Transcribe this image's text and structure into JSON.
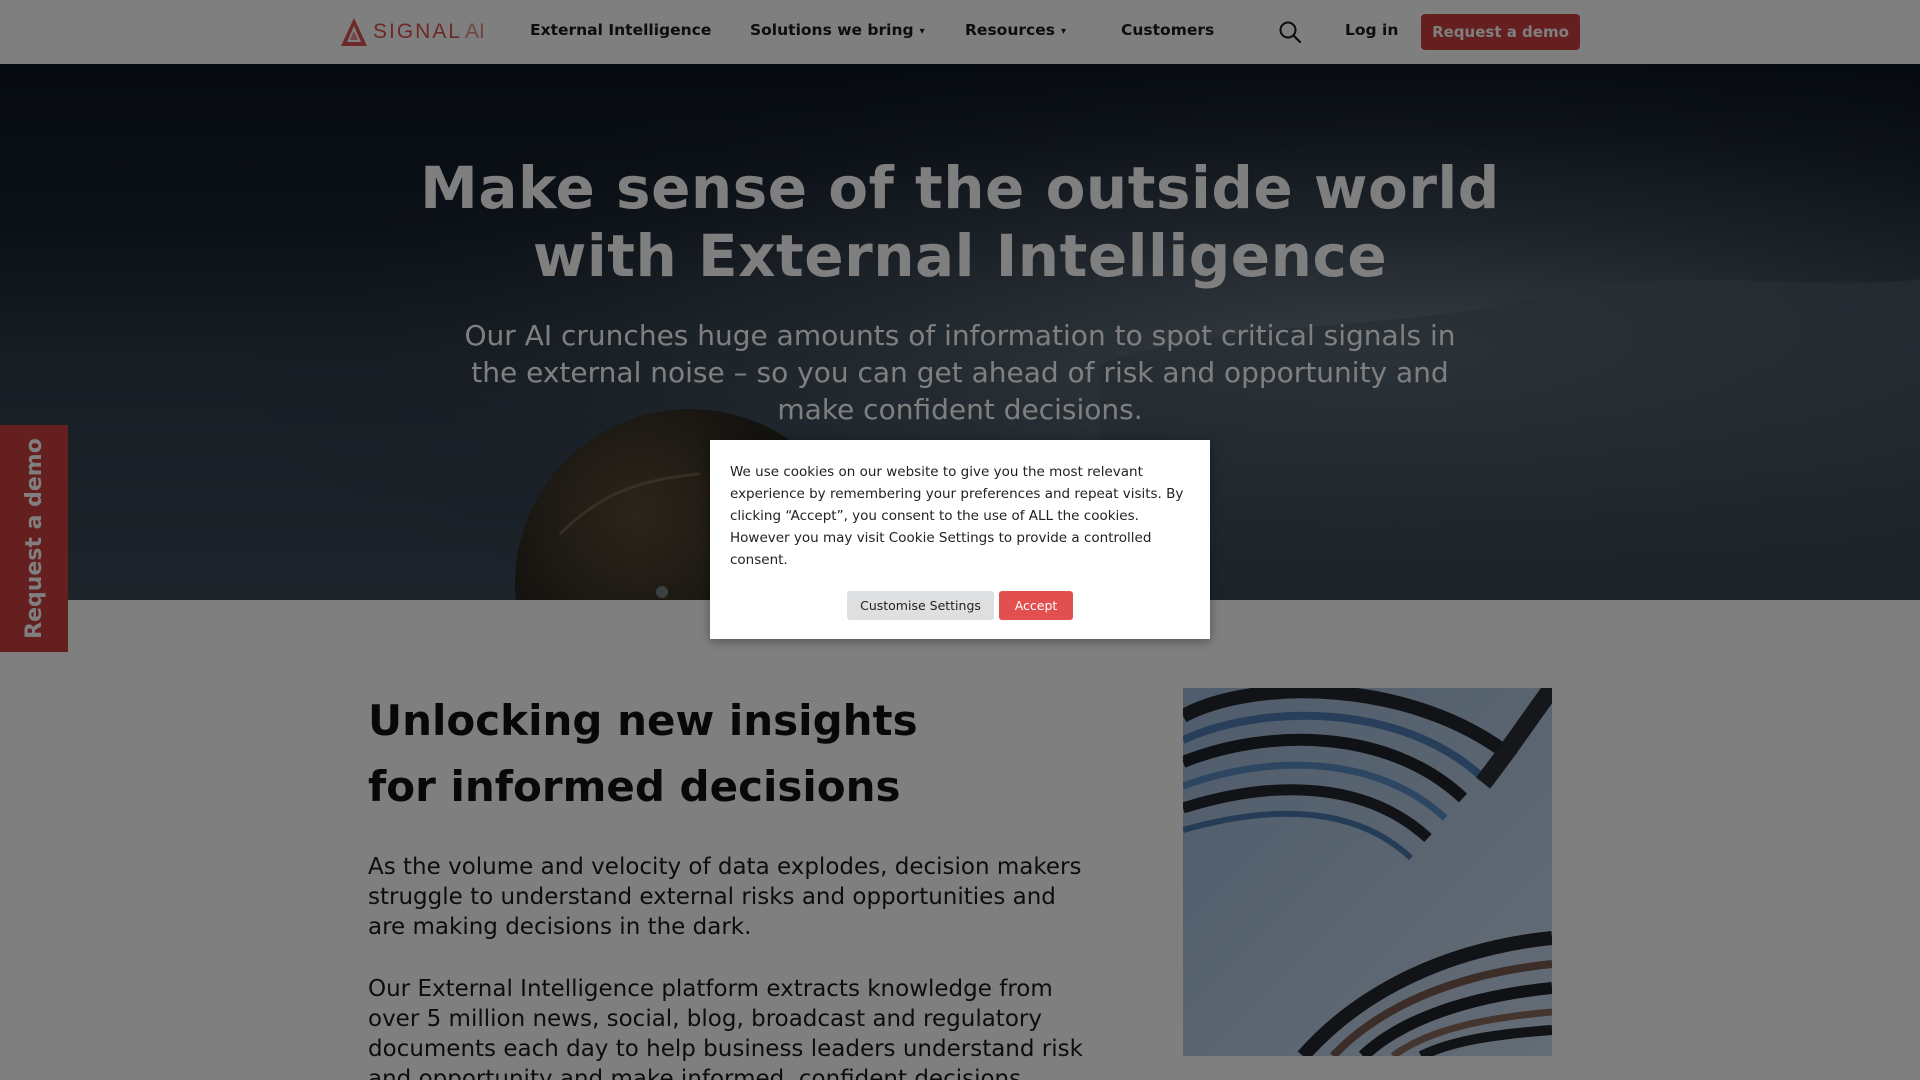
{
  "header": {
    "logo_text": "SIGNAL",
    "logo_ai": "AI",
    "nav": [
      {
        "label": "External Intelligence"
      },
      {
        "label": "Solutions we bring",
        "caret": "▾"
      },
      {
        "label": "Resources",
        "caret": "▾"
      },
      {
        "label": "Customers"
      }
    ],
    "search_icon": "search-icon",
    "login_label": "Log in",
    "demo_label": "Request a demo"
  },
  "hero": {
    "title_line1": "Make sense of the outside world",
    "title_line2": "with External Intelligence",
    "subtitle": "Our AI crunches huge amounts of information to spot critical signals in the external noise – so you can get ahead of risk and opportunity and make confident decisions."
  },
  "side_tab": {
    "label": "Request a demo"
  },
  "content": {
    "heading": "Unlocking new insights for informed decisions",
    "paragraph1": "As the volume and velocity of data explodes, decision makers struggle to understand external risks and opportunities and are making decisions in the dark.",
    "paragraph2": "Our External Intelligence platform extracts knowledge from over 5 million news, social, blog, broadcast and regulatory documents each day to help business leaders understand risk and opportunity and make informed, confident decisions based on"
  },
  "cookie": {
    "text": "We use cookies on our website to give you the most relevant experience by remembering your preferences and repeat visits. By clicking “Accept”, you consent to the use of ALL the cookies. However you may visit Cookie Settings to provide a controlled consent.",
    "customise_label": "Customise Settings",
    "accept_label": "Accept"
  },
  "colors": {
    "brand_red": "#ca3e3e",
    "accept_red": "#e14f4f",
    "overlay": "rgba(0,0,0,0.5)"
  }
}
